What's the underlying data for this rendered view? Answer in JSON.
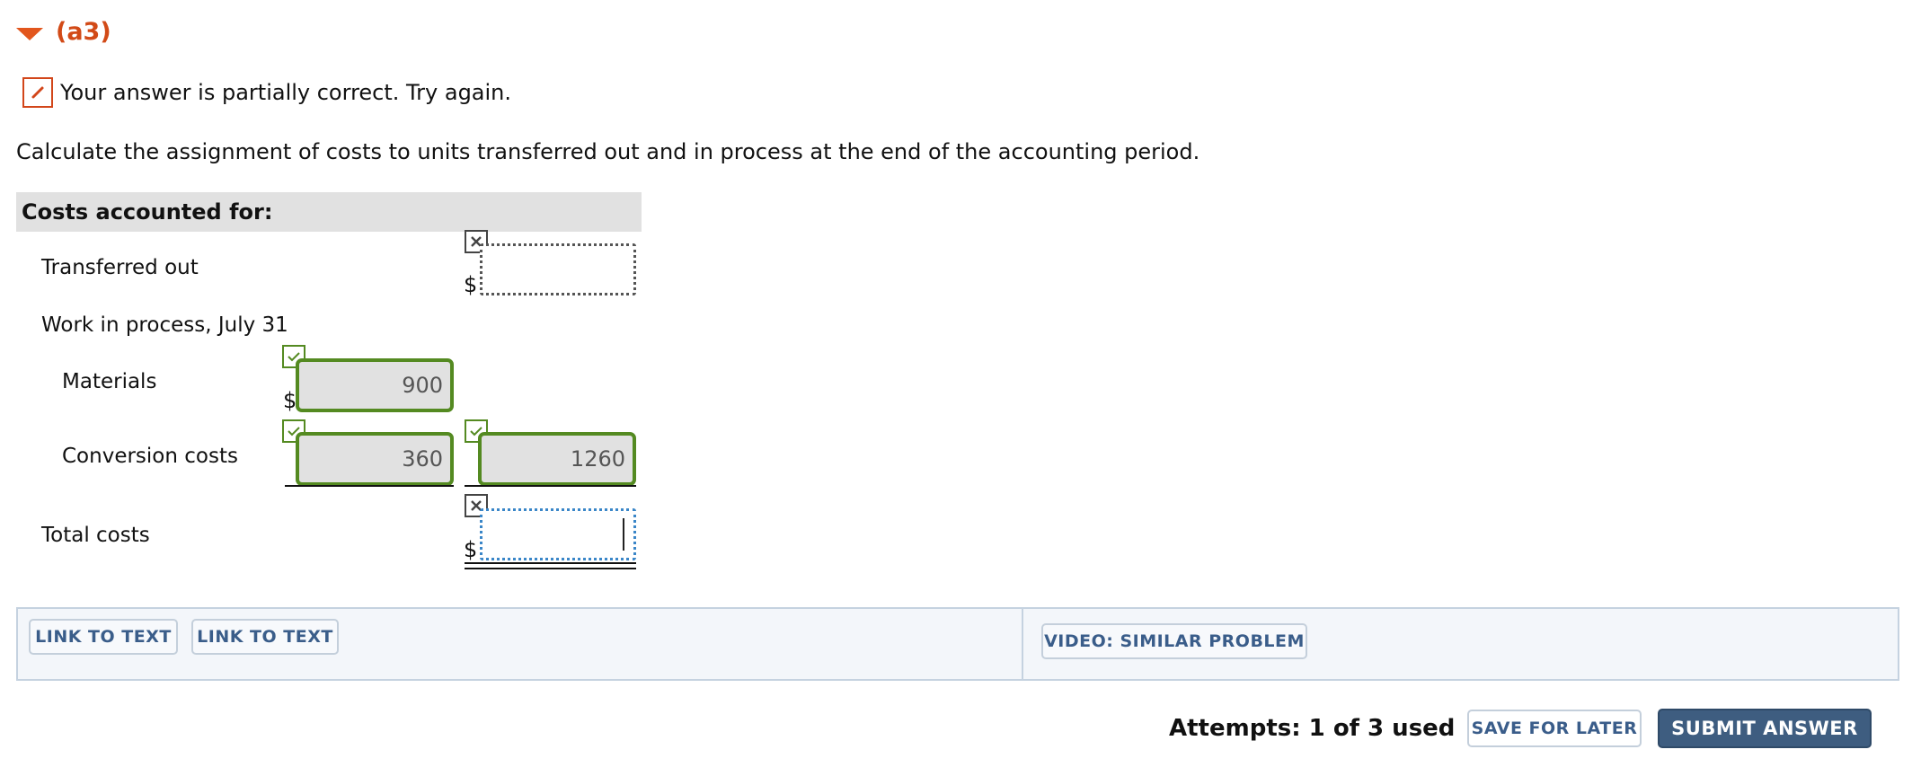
{
  "part": {
    "title": "(a3)"
  },
  "feedback": {
    "text": "Your answer is partially correct.  Try again."
  },
  "question": {
    "text": "Calculate the assignment of costs to units transferred out and in process at the end of the accounting period."
  },
  "table": {
    "section_label": "Costs accounted for:",
    "currency": "$",
    "rows": {
      "transferred_out": {
        "label": "Transferred out",
        "value": "",
        "status": "incorrect"
      },
      "wip": {
        "label": "Work in process, July 31"
      },
      "materials": {
        "label": "Materials",
        "value": "900",
        "status": "correct"
      },
      "conversion": {
        "label": "Conversion costs",
        "value": "360",
        "status": "correct",
        "subtotal": "1260",
        "subtotal_status": "correct"
      },
      "total": {
        "label": "Total costs",
        "value": "",
        "status": "incorrect"
      }
    }
  },
  "links": {
    "link1": "LINK TO TEXT",
    "link2": "LINK TO TEXT",
    "video": "VIDEO: SIMILAR PROBLEM"
  },
  "footer": {
    "attempts": "Attempts: 1 of 3 used",
    "save_label": "SAVE FOR LATER",
    "submit_label": "SUBMIT ANSWER"
  },
  "colors": {
    "accent_orange": "#d24a17",
    "correct_green": "#548a21",
    "submit_blue": "#3e5d80"
  }
}
